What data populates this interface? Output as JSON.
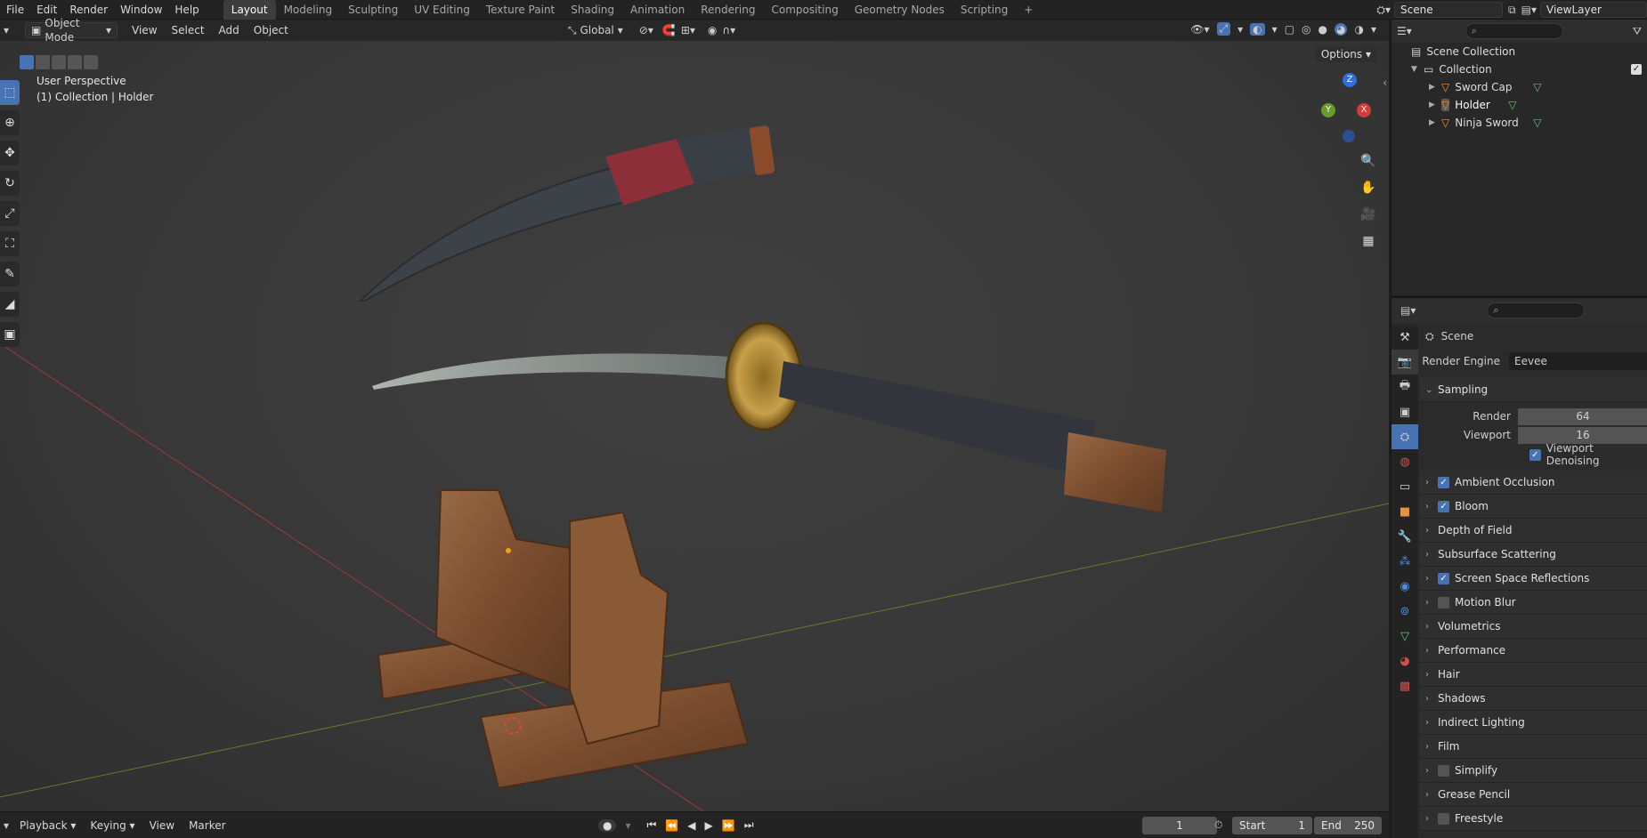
{
  "menu": [
    "File",
    "Edit",
    "Render",
    "Window",
    "Help"
  ],
  "workspaces": [
    "Layout",
    "Modeling",
    "Sculpting",
    "UV Editing",
    "Texture Paint",
    "Shading",
    "Animation",
    "Rendering",
    "Compositing",
    "Geometry Nodes",
    "Scripting"
  ],
  "workspace_add": "+",
  "scene_name": "Scene",
  "view_layer": "ViewLayer",
  "viewport_header": {
    "mode": "Object Mode",
    "menus": [
      "View",
      "Select",
      "Add",
      "Object"
    ],
    "transform_orientation": "Global",
    "options": "Options"
  },
  "viewport_overlay": {
    "line1": "User Perspective",
    "line2": "(1) Collection | Holder"
  },
  "gizmo": {
    "z": "Z",
    "x": "X",
    "y": "Y"
  },
  "outliner": {
    "root": "Scene Collection",
    "collection": "Collection",
    "objects": [
      "Sword Cap",
      "Holder",
      "Ninja Sword"
    ]
  },
  "properties": {
    "context": "Scene",
    "render_engine_label": "Render Engine",
    "render_engine": "Eevee",
    "sampling": "Sampling",
    "render_label": "Render",
    "render_samples": "64",
    "viewport_label": "Viewport",
    "viewport_samples": "16",
    "viewport_denoising": "Viewport Denoising",
    "panels": [
      {
        "label": "Ambient Occlusion",
        "checkbox": "on"
      },
      {
        "label": "Bloom",
        "checkbox": "on"
      },
      {
        "label": "Depth of Field",
        "checkbox": "none"
      },
      {
        "label": "Subsurface Scattering",
        "checkbox": "none"
      },
      {
        "label": "Screen Space Reflections",
        "checkbox": "on"
      },
      {
        "label": "Motion Blur",
        "checkbox": "off"
      },
      {
        "label": "Volumetrics",
        "checkbox": "none"
      },
      {
        "label": "Performance",
        "checkbox": "none"
      },
      {
        "label": "Hair",
        "checkbox": "none"
      },
      {
        "label": "Shadows",
        "checkbox": "none"
      },
      {
        "label": "Indirect Lighting",
        "checkbox": "none"
      },
      {
        "label": "Film",
        "checkbox": "none"
      },
      {
        "label": "Simplify",
        "checkbox": "off"
      },
      {
        "label": "Grease Pencil",
        "checkbox": "none"
      },
      {
        "label": "Freestyle",
        "checkbox": "off"
      }
    ]
  },
  "timeline": {
    "menus": [
      "Playback",
      "Keying",
      "View",
      "Marker"
    ],
    "current_frame": "1",
    "start_label": "Start",
    "start": "1",
    "end_label": "End",
    "end": "250"
  },
  "colors": {
    "accent": "#4772b3",
    "axis_x": "#9a3b3b",
    "axis_y": "#5f7f2a"
  }
}
